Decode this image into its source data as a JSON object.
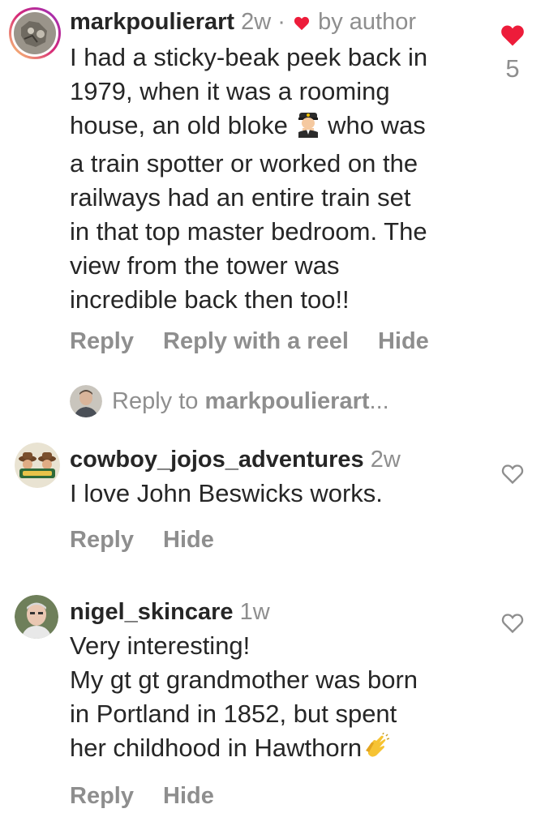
{
  "comments": [
    {
      "username": "markpoulierart",
      "age": "2w",
      "separator": "·",
      "liked_by": "by author",
      "body_lines": [
        "I had a sticky-beak peek back in",
        "1979, when it was a rooming",
        "house, an old bloke",
        "who was",
        "a train spotter or worked on the",
        "railways had an entire train set",
        "in that top master bedroom. The",
        "view from the tower was",
        "incredible back then too!!"
      ],
      "likes": "5",
      "actions": [
        "Reply",
        "Reply with a reel",
        "Hide"
      ]
    },
    {
      "username": "cowboy_jojos_adventures",
      "age": "2w",
      "body_lines": [
        "I love John Beswicks works."
      ],
      "actions": [
        "Reply",
        "Hide"
      ]
    },
    {
      "username": "nigel_skincare",
      "age": "1w",
      "body_lines": [
        "Very interesting!",
        "My gt gt grandmother was born",
        "in Portland in 1852, but spent",
        "her childhood in Hawthorn"
      ],
      "actions": [
        "Reply",
        "Hide"
      ]
    }
  ],
  "reply_prompt": {
    "prefix": "Reply to ",
    "username": "markpoulierart",
    "suffix": "..."
  },
  "colors": {
    "like_red": "#ed1c3a",
    "muted": "#8e8e8e",
    "text": "#262626",
    "avatar_ring": "#d6249f"
  },
  "icons": [
    "heart-filled-icon",
    "heart-outline-icon",
    "pilot-emoji-icon",
    "clapping-emoji-icon"
  ]
}
